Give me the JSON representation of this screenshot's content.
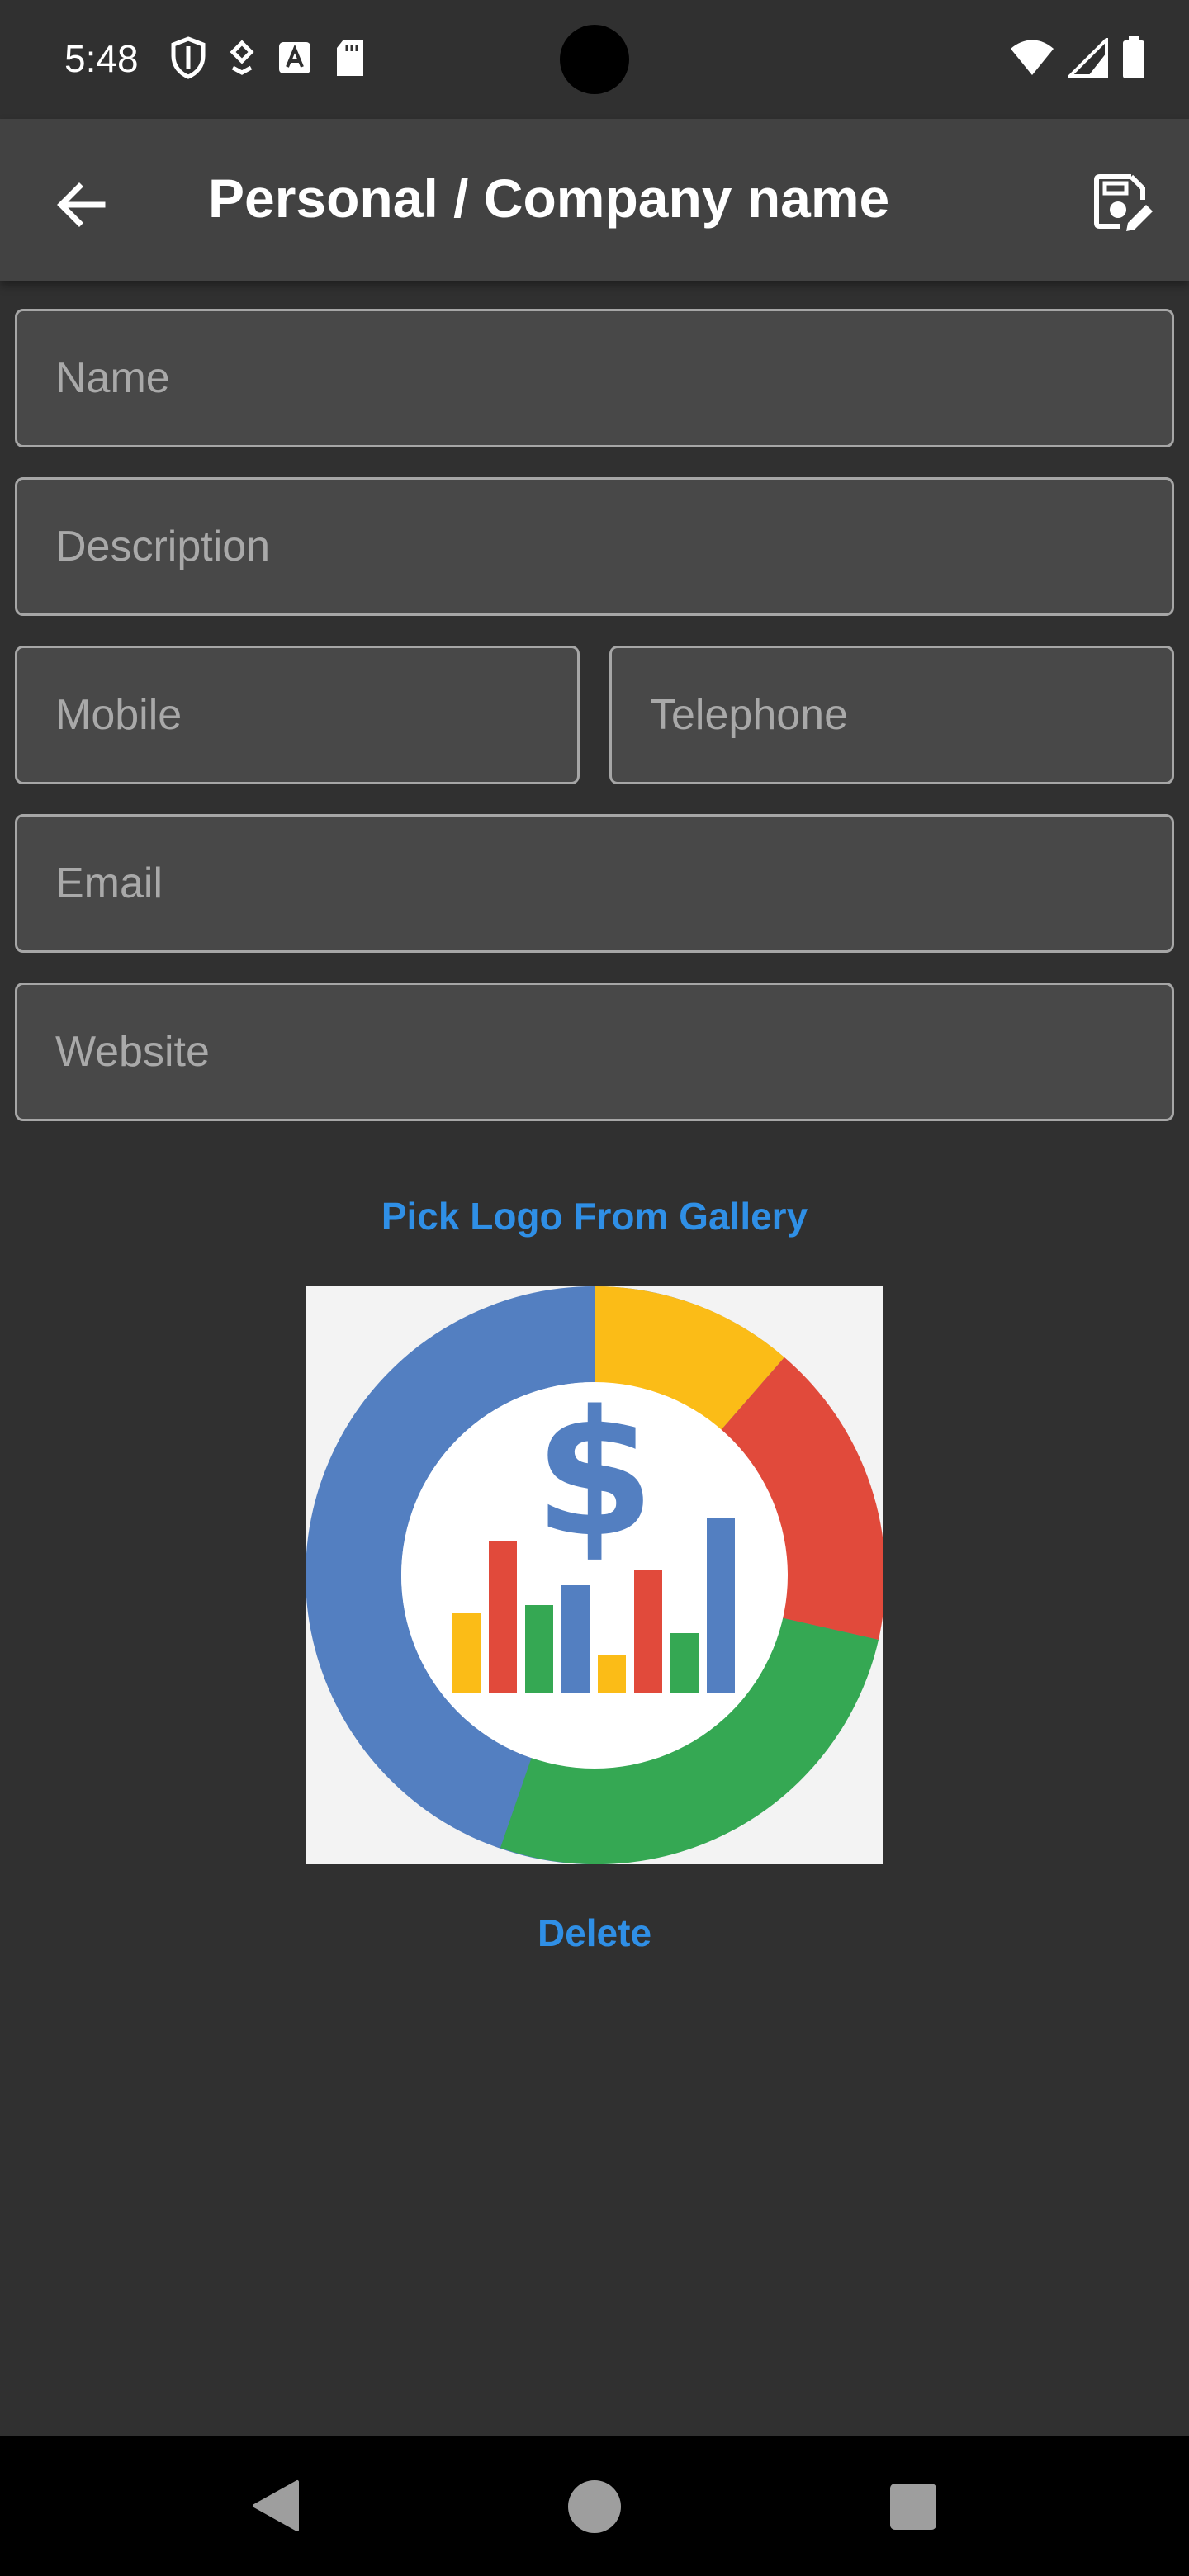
{
  "status_bar": {
    "time": "5:48",
    "icons_left": [
      "shield-icon",
      "location-badge-icon",
      "a-badge-icon",
      "sd-card-icon"
    ],
    "icons_right": [
      "wifi-icon",
      "cell-signal-icon",
      "battery-icon"
    ]
  },
  "app_bar": {
    "title": "Personal / Company name",
    "back_icon": "arrow-back-icon",
    "save_icon": "save-edit-icon"
  },
  "form": {
    "name": {
      "placeholder": "Name",
      "value": ""
    },
    "description": {
      "placeholder": "Description",
      "value": ""
    },
    "mobile": {
      "placeholder": "Mobile",
      "value": ""
    },
    "telephone": {
      "placeholder": "Telephone",
      "value": ""
    },
    "email": {
      "placeholder": "Email",
      "value": ""
    },
    "website": {
      "placeholder": "Website",
      "value": ""
    }
  },
  "actions": {
    "pick_logo": "Pick Logo From Gallery",
    "delete": "Delete"
  },
  "logo": {
    "symbol": "$",
    "colors": {
      "blue": "#537fc1",
      "yellow": "#fbbc17",
      "red": "#e14a3b",
      "green": "#35a853",
      "background": "#f3f3f3"
    }
  },
  "theme": {
    "background": "#303030",
    "app_bar": "#424242",
    "accent": "#2f8fe6",
    "field_border": "#a6a6a6"
  },
  "nav_bar": {
    "icons": [
      "nav-back-icon",
      "nav-home-icon",
      "nav-recents-icon"
    ]
  }
}
